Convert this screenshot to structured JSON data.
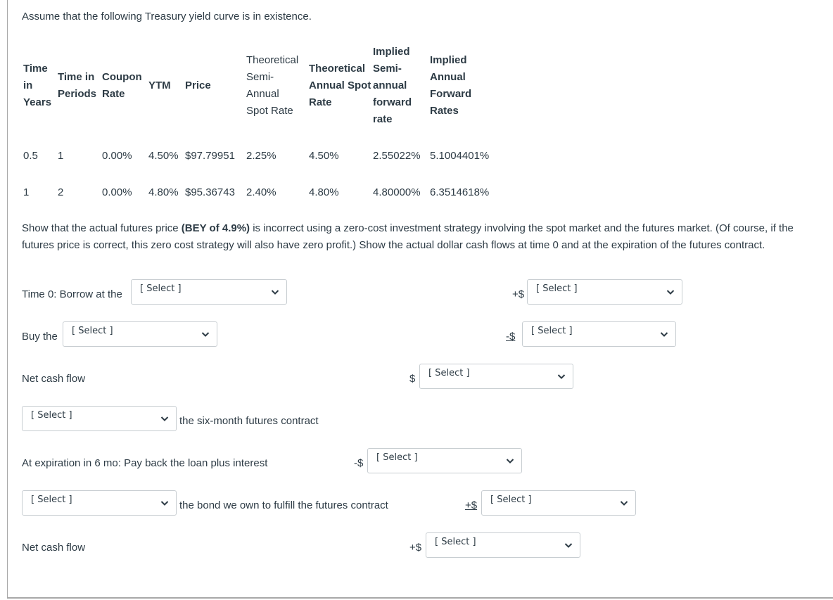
{
  "intro": "Assume that the following Treasury yield curve is in existence.",
  "table": {
    "headers": [
      {
        "lines": [
          "Time",
          "in",
          "Years"
        ]
      },
      {
        "lines": [
          "Time in",
          "Periods"
        ]
      },
      {
        "lines": [
          "Coupon",
          "Rate"
        ]
      },
      {
        "lines": [
          "YTM"
        ]
      },
      {
        "lines": [
          "Price"
        ]
      },
      {
        "lines": [
          "Theoretical",
          "Semi-",
          "Annual",
          "Spot Rate"
        ]
      },
      {
        "lines": [
          "Theoretical",
          "Annual Spot",
          "Rate"
        ]
      },
      {
        "lines": [
          "Implied",
          "Semi-",
          "annual",
          "forward",
          "rate"
        ]
      },
      {
        "lines": [
          "Implied",
          "Annual",
          "Forward",
          "Rates"
        ]
      }
    ],
    "rows": [
      [
        "0.5",
        "1",
        "0.00%",
        "4.50%",
        "$97.79951",
        "2.25%",
        "4.50%",
        "2.55022%",
        "5.1004401%"
      ],
      [
        "1",
        "2",
        "0.00%",
        "4.80%",
        "$95.36743",
        "2.40%",
        "4.80%",
        "4.80000%",
        "6.3514618%"
      ]
    ]
  },
  "question": {
    "before_bold": "Show that the actual futures price ",
    "bold": "(BEY of 4.9%)",
    "after_bold": " is incorrect using a zero-cost investment strategy involving the spot market and the futures market.  (Of course, if the futures price is correct, this zero cost strategy will also have zero profit.)  Show the actual dollar cash flows at time 0 and at the expiration of the futures contract."
  },
  "steps": {
    "borrow_label": "Time 0: Borrow at the",
    "borrow_select": "[ Select ]",
    "borrow_sign": "+$",
    "borrow_amount_select": "[ Select ]",
    "buy_label": "Buy the",
    "buy_select": "[ Select ]",
    "buy_sign": "-$",
    "buy_amount_select": "[ Select ]",
    "net1_label": "Net cash flow",
    "net1_sign": "$",
    "net1_select": "[ Select ]",
    "futures_action_select": "[ Select ]",
    "futures_label": "the six-month futures contract",
    "expiration_label": "At expiration in 6 mo: Pay back the loan plus interest",
    "payback_sign": "-$",
    "payback_select": "[ Select ]",
    "bond_action_select": "[ Select ]",
    "bond_label": "the bond we own to fulfill the futures contract",
    "bond_sign": "+$",
    "bond_amount_select": "[ Select ]",
    "net2_label": "Net cash flow",
    "net2_sign": "+$",
    "net2_select": "[ Select ]"
  }
}
